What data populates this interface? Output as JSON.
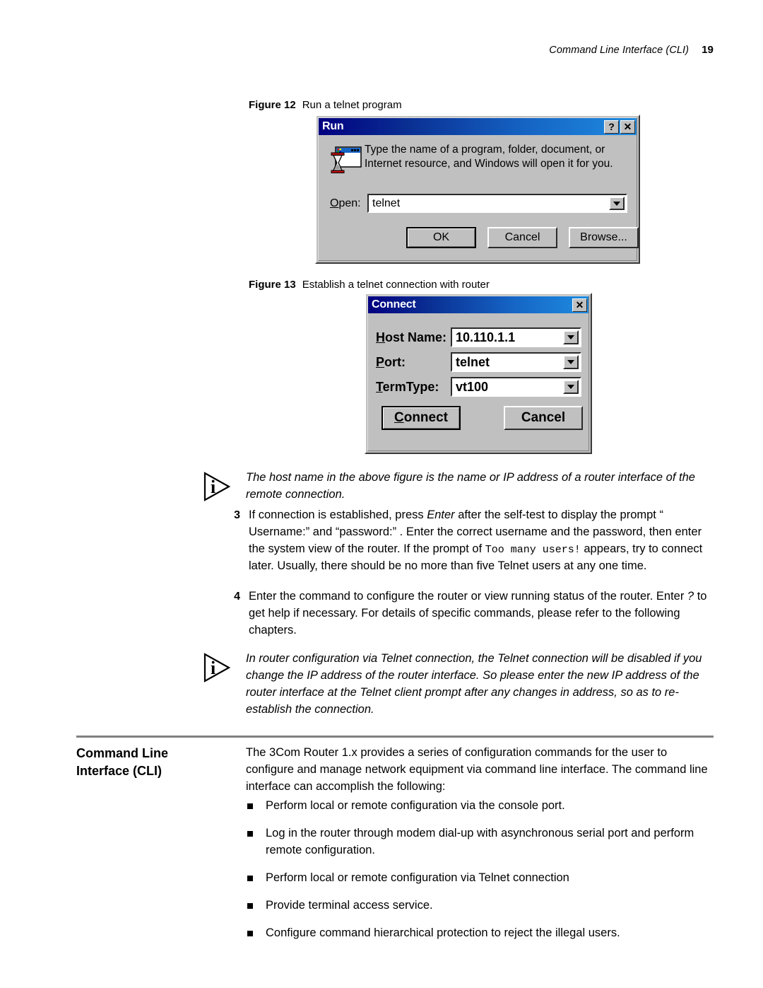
{
  "header": {
    "title": "Command Line Interface (CLI)",
    "page_number": "19"
  },
  "figures": [
    {
      "label": "Figure 12",
      "caption": "Run a telnet program"
    },
    {
      "label": "Figure 13",
      "caption": "Establish a telnet connection with router"
    }
  ],
  "run_dialog": {
    "title": "Run",
    "help_button": "?",
    "close_button": "✕",
    "description": "Type the name of a program, folder, document, or Internet resource, and Windows will open it for you.",
    "open_label_accel": "O",
    "open_label_rest": "pen:",
    "open_value": "telnet",
    "icon": "run-program-hourglass-icon",
    "buttons": [
      {
        "label": "OK",
        "default": true
      },
      {
        "label": "Cancel",
        "default": false
      },
      {
        "label": "Browse...",
        "default": false
      }
    ]
  },
  "connect_dialog": {
    "title": "Connect",
    "close_button": "✕",
    "fields": [
      {
        "accel": "H",
        "label_rest": "ost Name:",
        "value": "10.110.1.1"
      },
      {
        "accel": "P",
        "label_rest": "ort:",
        "value": "telnet"
      },
      {
        "accel": "T",
        "label_rest": "ermType:",
        "value": "vt100"
      }
    ],
    "buttons": [
      {
        "accel": "C",
        "label_rest": "onnect"
      },
      {
        "accel": "",
        "label_rest": "Cancel"
      }
    ]
  },
  "notes": [
    {
      "icon": "note-information-triangle-icon",
      "glyph": "i",
      "text": "The host name in the above figure is the name or IP address of a router interface of the remote connection."
    },
    {
      "icon": "note-information-triangle-icon",
      "glyph": "i",
      "text": "In router configuration via Telnet connection, the Telnet connection will be disabled if you change the IP address of the router interface. So please enter the new IP address of the router interface at the Telnet client prompt after any changes in address, so as to re-establish the connection."
    }
  ],
  "steps": [
    {
      "number": "3",
      "part1": "If connection is established, press ",
      "italic1": "Enter",
      "part2": " after the self-test to display the prompt “ Username:” and “password:” . Enter the correct username and the password, then enter the system view of the router. If the prompt of ",
      "mono": "Too many users!",
      "part3": " appears, try to connect later. Usually, there should be no more than five Telnet users at any one time."
    },
    {
      "number": "4",
      "part1": "Enter the command to configure the router or view running status of the router. Enter ",
      "italic1": "?",
      "part2": " to get help if necessary. For details of specific commands, please refer to the following chapters.",
      "mono": "",
      "part3": ""
    }
  ],
  "section": {
    "heading_line1": "Command Line",
    "heading_line2": "Interface (CLI)",
    "intro": "The 3Com Router 1.x provides a series of configuration commands for the user to configure and manage network equipment via command line interface. The command line interface can accomplish the following:",
    "bullets": [
      "Perform local or remote configuration via the console port.",
      "Log in the router through modem dial-up with asynchronous serial port and perform remote configuration.",
      "Perform local or remote configuration via Telnet connection",
      "Provide terminal access service.",
      "Configure command hierarchical protection to reject the illegal users."
    ]
  },
  "colors": {
    "titlebar_start": "#000080",
    "titlebar_end": "#1f8ce0",
    "dialog_face": "#c0c0c0",
    "rule": "#808080"
  }
}
